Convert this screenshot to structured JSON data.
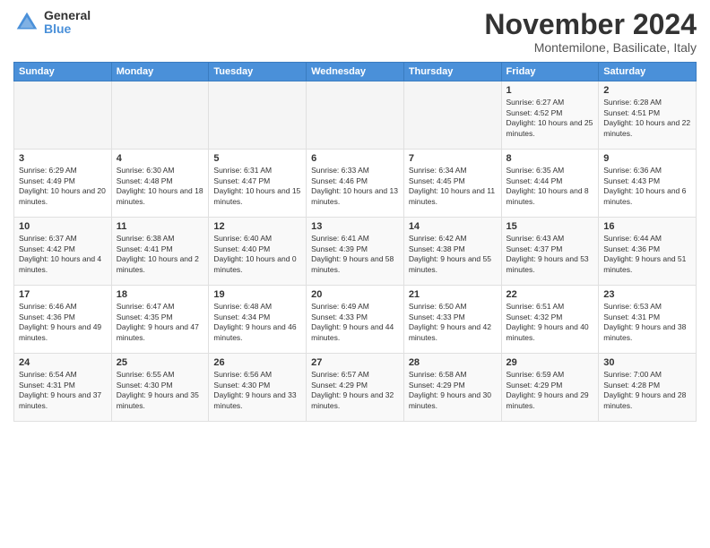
{
  "logo": {
    "general": "General",
    "blue": "Blue"
  },
  "title": "November 2024",
  "location": "Montemilone, Basilicate, Italy",
  "weekdays": [
    "Sunday",
    "Monday",
    "Tuesday",
    "Wednesday",
    "Thursday",
    "Friday",
    "Saturday"
  ],
  "weeks": [
    [
      {
        "day": "",
        "sunrise": "",
        "sunset": "",
        "daylight": ""
      },
      {
        "day": "",
        "sunrise": "",
        "sunset": "",
        "daylight": ""
      },
      {
        "day": "",
        "sunrise": "",
        "sunset": "",
        "daylight": ""
      },
      {
        "day": "",
        "sunrise": "",
        "sunset": "",
        "daylight": ""
      },
      {
        "day": "",
        "sunrise": "",
        "sunset": "",
        "daylight": ""
      },
      {
        "day": "1",
        "sunrise": "Sunrise: 6:27 AM",
        "sunset": "Sunset: 4:52 PM",
        "daylight": "Daylight: 10 hours and 25 minutes."
      },
      {
        "day": "2",
        "sunrise": "Sunrise: 6:28 AM",
        "sunset": "Sunset: 4:51 PM",
        "daylight": "Daylight: 10 hours and 22 minutes."
      }
    ],
    [
      {
        "day": "3",
        "sunrise": "Sunrise: 6:29 AM",
        "sunset": "Sunset: 4:49 PM",
        "daylight": "Daylight: 10 hours and 20 minutes."
      },
      {
        "day": "4",
        "sunrise": "Sunrise: 6:30 AM",
        "sunset": "Sunset: 4:48 PM",
        "daylight": "Daylight: 10 hours and 18 minutes."
      },
      {
        "day": "5",
        "sunrise": "Sunrise: 6:31 AM",
        "sunset": "Sunset: 4:47 PM",
        "daylight": "Daylight: 10 hours and 15 minutes."
      },
      {
        "day": "6",
        "sunrise": "Sunrise: 6:33 AM",
        "sunset": "Sunset: 4:46 PM",
        "daylight": "Daylight: 10 hours and 13 minutes."
      },
      {
        "day": "7",
        "sunrise": "Sunrise: 6:34 AM",
        "sunset": "Sunset: 4:45 PM",
        "daylight": "Daylight: 10 hours and 11 minutes."
      },
      {
        "day": "8",
        "sunrise": "Sunrise: 6:35 AM",
        "sunset": "Sunset: 4:44 PM",
        "daylight": "Daylight: 10 hours and 8 minutes."
      },
      {
        "day": "9",
        "sunrise": "Sunrise: 6:36 AM",
        "sunset": "Sunset: 4:43 PM",
        "daylight": "Daylight: 10 hours and 6 minutes."
      }
    ],
    [
      {
        "day": "10",
        "sunrise": "Sunrise: 6:37 AM",
        "sunset": "Sunset: 4:42 PM",
        "daylight": "Daylight: 10 hours and 4 minutes."
      },
      {
        "day": "11",
        "sunrise": "Sunrise: 6:38 AM",
        "sunset": "Sunset: 4:41 PM",
        "daylight": "Daylight: 10 hours and 2 minutes."
      },
      {
        "day": "12",
        "sunrise": "Sunrise: 6:40 AM",
        "sunset": "Sunset: 4:40 PM",
        "daylight": "Daylight: 10 hours and 0 minutes."
      },
      {
        "day": "13",
        "sunrise": "Sunrise: 6:41 AM",
        "sunset": "Sunset: 4:39 PM",
        "daylight": "Daylight: 9 hours and 58 minutes."
      },
      {
        "day": "14",
        "sunrise": "Sunrise: 6:42 AM",
        "sunset": "Sunset: 4:38 PM",
        "daylight": "Daylight: 9 hours and 55 minutes."
      },
      {
        "day": "15",
        "sunrise": "Sunrise: 6:43 AM",
        "sunset": "Sunset: 4:37 PM",
        "daylight": "Daylight: 9 hours and 53 minutes."
      },
      {
        "day": "16",
        "sunrise": "Sunrise: 6:44 AM",
        "sunset": "Sunset: 4:36 PM",
        "daylight": "Daylight: 9 hours and 51 minutes."
      }
    ],
    [
      {
        "day": "17",
        "sunrise": "Sunrise: 6:46 AM",
        "sunset": "Sunset: 4:36 PM",
        "daylight": "Daylight: 9 hours and 49 minutes."
      },
      {
        "day": "18",
        "sunrise": "Sunrise: 6:47 AM",
        "sunset": "Sunset: 4:35 PM",
        "daylight": "Daylight: 9 hours and 47 minutes."
      },
      {
        "day": "19",
        "sunrise": "Sunrise: 6:48 AM",
        "sunset": "Sunset: 4:34 PM",
        "daylight": "Daylight: 9 hours and 46 minutes."
      },
      {
        "day": "20",
        "sunrise": "Sunrise: 6:49 AM",
        "sunset": "Sunset: 4:33 PM",
        "daylight": "Daylight: 9 hours and 44 minutes."
      },
      {
        "day": "21",
        "sunrise": "Sunrise: 6:50 AM",
        "sunset": "Sunset: 4:33 PM",
        "daylight": "Daylight: 9 hours and 42 minutes."
      },
      {
        "day": "22",
        "sunrise": "Sunrise: 6:51 AM",
        "sunset": "Sunset: 4:32 PM",
        "daylight": "Daylight: 9 hours and 40 minutes."
      },
      {
        "day": "23",
        "sunrise": "Sunrise: 6:53 AM",
        "sunset": "Sunset: 4:31 PM",
        "daylight": "Daylight: 9 hours and 38 minutes."
      }
    ],
    [
      {
        "day": "24",
        "sunrise": "Sunrise: 6:54 AM",
        "sunset": "Sunset: 4:31 PM",
        "daylight": "Daylight: 9 hours and 37 minutes."
      },
      {
        "day": "25",
        "sunrise": "Sunrise: 6:55 AM",
        "sunset": "Sunset: 4:30 PM",
        "daylight": "Daylight: 9 hours and 35 minutes."
      },
      {
        "day": "26",
        "sunrise": "Sunrise: 6:56 AM",
        "sunset": "Sunset: 4:30 PM",
        "daylight": "Daylight: 9 hours and 33 minutes."
      },
      {
        "day": "27",
        "sunrise": "Sunrise: 6:57 AM",
        "sunset": "Sunset: 4:29 PM",
        "daylight": "Daylight: 9 hours and 32 minutes."
      },
      {
        "day": "28",
        "sunrise": "Sunrise: 6:58 AM",
        "sunset": "Sunset: 4:29 PM",
        "daylight": "Daylight: 9 hours and 30 minutes."
      },
      {
        "day": "29",
        "sunrise": "Sunrise: 6:59 AM",
        "sunset": "Sunset: 4:29 PM",
        "daylight": "Daylight: 9 hours and 29 minutes."
      },
      {
        "day": "30",
        "sunrise": "Sunrise: 7:00 AM",
        "sunset": "Sunset: 4:28 PM",
        "daylight": "Daylight: 9 hours and 28 minutes."
      }
    ]
  ]
}
